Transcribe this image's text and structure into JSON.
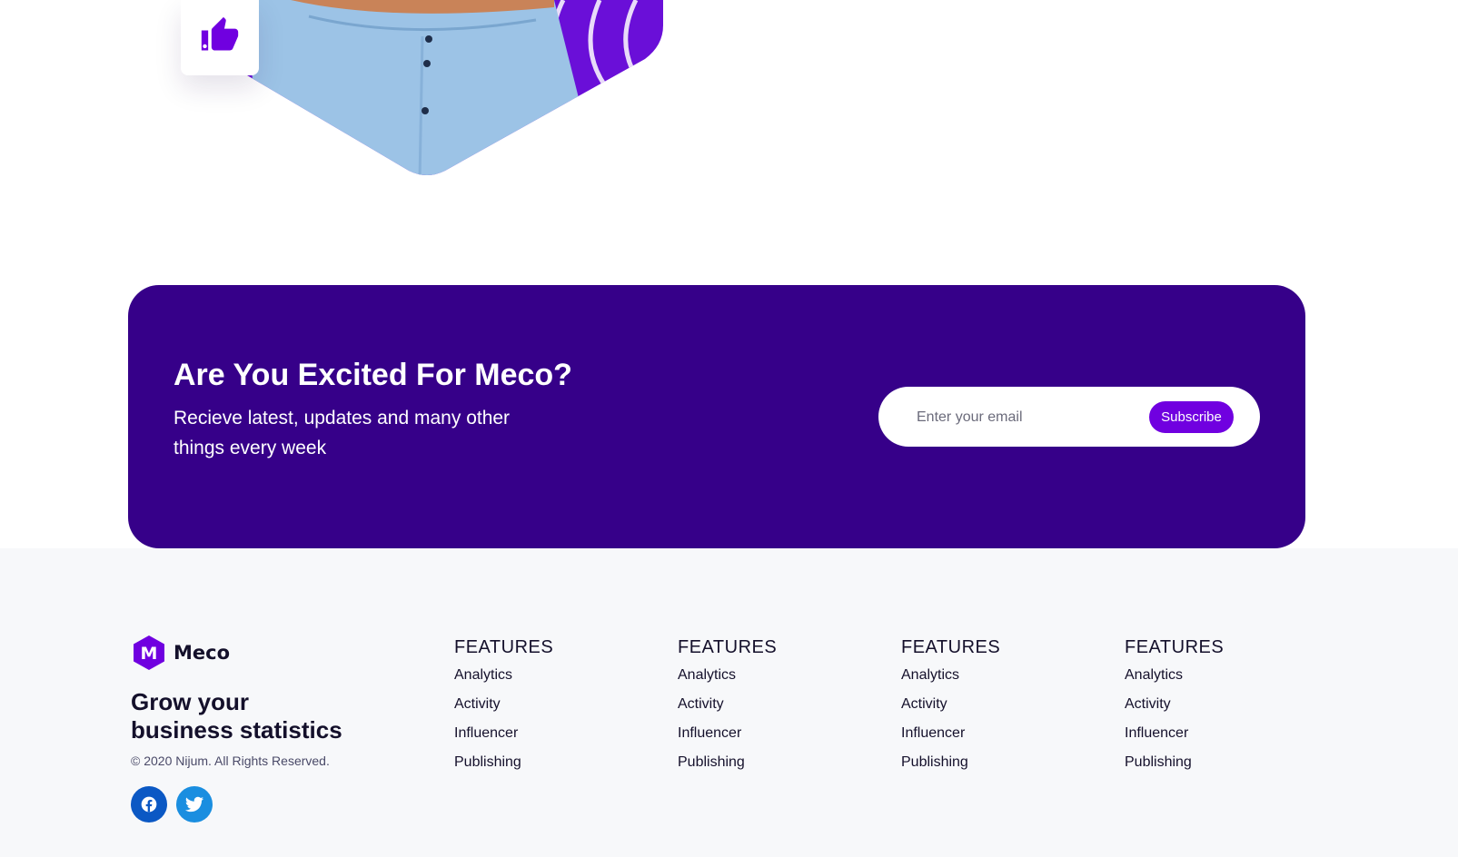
{
  "newsletter": {
    "title": "Are You Excited For Meco?",
    "subtitle": "Recieve latest, updates and many other things every week",
    "email_placeholder": "Enter your email",
    "subscribe_label": "Subscribe"
  },
  "footer": {
    "brand": {
      "logo_letter": "M",
      "name": "Meco"
    },
    "tagline_line1": "Grow your",
    "tagline_line2": "business statistics",
    "copyright": "© 2020 Nijum. All Rights Reserved.",
    "socials": [
      {
        "icon": "facebook-icon"
      },
      {
        "icon": "twitter-icon"
      }
    ],
    "columns": [
      {
        "title": "FEATURES",
        "links": [
          "Analytics",
          "Activity",
          "Influencer",
          "Publishing"
        ]
      },
      {
        "title": "FEATURES",
        "links": [
          "Analytics",
          "Activity",
          "Influencer",
          "Publishing"
        ]
      },
      {
        "title": "FEATURES",
        "links": [
          "Analytics",
          "Activity",
          "Influencer",
          "Publishing"
        ]
      },
      {
        "title": "FEATURES",
        "links": [
          "Analytics",
          "Activity",
          "Influencer",
          "Publishing"
        ]
      }
    ]
  },
  "colors": {
    "accent": "#7000e0",
    "banner": "#360089",
    "footer_bg": "#f7f8fa",
    "text_dark": "#14102b"
  },
  "icons": {
    "like": "thumbs-up-icon"
  }
}
